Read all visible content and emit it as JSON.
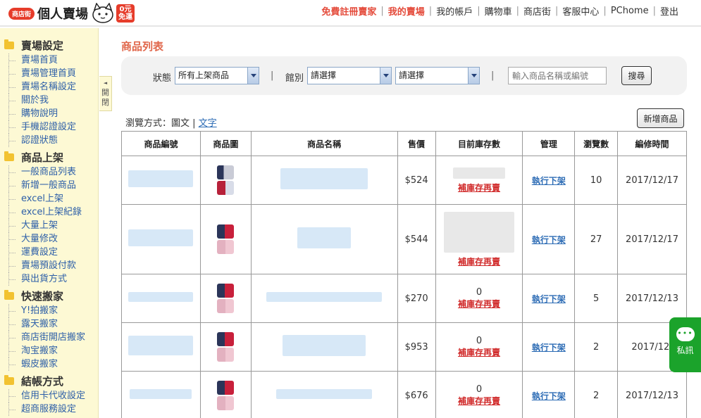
{
  "header": {
    "logo_badge": "商店街",
    "logo_text": "個人賣場",
    "logo_free_top": "0元",
    "logo_free_bottom": "免運",
    "nav": [
      {
        "label": "免費註冊賣家",
        "red": true
      },
      {
        "label": "我的賣場",
        "red": true
      },
      {
        "label": "我的帳戶",
        "red": false
      },
      {
        "label": "購物車",
        "red": false
      },
      {
        "label": "商店街",
        "red": false
      },
      {
        "label": "客服中心",
        "red": false
      },
      {
        "label": "PChome",
        "red": false
      },
      {
        "label": "登出",
        "red": false
      }
    ]
  },
  "sidebar": {
    "sections": [
      {
        "title": "賣場設定",
        "items": [
          "賣場首頁",
          "賣場管理首頁",
          "賣場名稱設定",
          "關於我",
          "購物說明",
          "手機認證設定",
          "認證狀態"
        ]
      },
      {
        "title": "商品上架",
        "items": [
          "一般商品列表",
          "新增一般商品",
          "excel上架",
          "excel上架紀錄",
          "大量上架",
          "大量修改",
          "運費設定",
          "賣場預設付款",
          "與出貨方式"
        ]
      },
      {
        "title": "快速搬家",
        "items": [
          "Y!拍搬家",
          "露天搬家",
          "商店街開店搬家",
          "淘宝搬家",
          "蝦皮搬家"
        ]
      },
      {
        "title": "結帳方式",
        "items": [
          "信用卡代收設定",
          "超商服務設定"
        ]
      }
    ],
    "collapse_label_1": "開",
    "collapse_label_2": "閉"
  },
  "main": {
    "page_title": "商品列表",
    "filter": {
      "status_label": "狀態",
      "status_value": "所有上架商品",
      "category_label": "館別",
      "category_value": "請選擇",
      "subcategory_value": "請選擇",
      "search_placeholder": "輸入商品名稱或編號",
      "search_button": "搜尋"
    },
    "view_mode_label": "瀏覽方式：圖文",
    "view_mode_text_link": "文字",
    "add_product_button": "新增商品",
    "table": {
      "headers": [
        "商品編號",
        "商品圖",
        "商品名稱",
        "售價",
        "目前庫存數",
        "管理",
        "瀏覽數",
        "編修時間"
      ],
      "restock_label": "補庫存再賣",
      "manage_label": "執行下架",
      "rows": [
        {
          "price": "$524",
          "stock": "",
          "views": "10",
          "edited": "2017/12/17"
        },
        {
          "price": "$544",
          "stock": "",
          "views": "27",
          "edited": "2017/12/17"
        },
        {
          "price": "$270",
          "stock": "0",
          "views": "5",
          "edited": "2017/12/13"
        },
        {
          "price": "$953",
          "stock": "0",
          "views": "2",
          "edited": "2017/12/"
        },
        {
          "price": "$676",
          "stock": "0",
          "views": "2",
          "edited": "2017/12/13"
        }
      ]
    }
  },
  "chat": {
    "label": "私訊"
  },
  "colors": {
    "accent_red": "#e44b3b",
    "sidebar_bg": "#fdf9d4",
    "link_blue": "#2d5fa8",
    "chat_green": "#1ba32b"
  }
}
